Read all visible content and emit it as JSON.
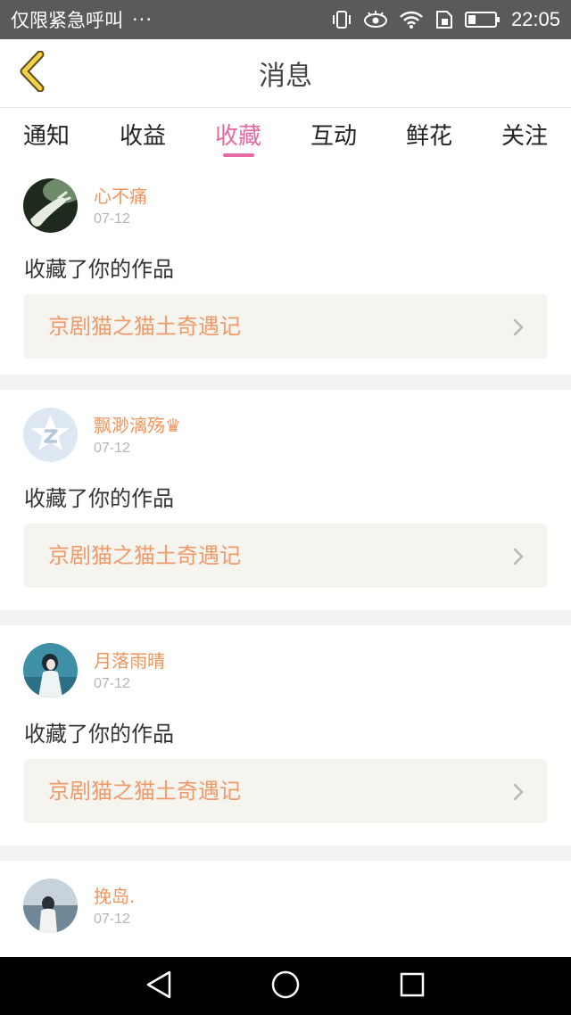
{
  "status_bar": {
    "notice": "仅限紧急呼叫",
    "more": "···",
    "time": "22:05",
    "icons": [
      "vibrate-icon",
      "eye-icon",
      "wifi-icon",
      "sim-icon",
      "battery-icon"
    ]
  },
  "header": {
    "title": "消息",
    "back_icon": "chevron-left-icon"
  },
  "tabs": [
    {
      "label": "通知",
      "active": false
    },
    {
      "label": "收益",
      "active": false
    },
    {
      "label": "收藏",
      "active": true
    },
    {
      "label": "互动",
      "active": false
    },
    {
      "label": "鲜花",
      "active": false
    },
    {
      "label": "关注",
      "active": false
    }
  ],
  "messages": [
    {
      "username": "心不痛",
      "date": "07-12",
      "action": "收藏了你的作品",
      "work_title": "京剧猫之猫土奇遇记"
    },
    {
      "username": "飘渺漓殇♛",
      "date": "07-12",
      "action": "收藏了你的作品",
      "work_title": "京剧猫之猫土奇遇记"
    },
    {
      "username": "月落雨晴",
      "date": "07-12",
      "action": "收藏了你的作品",
      "work_title": "京剧猫之猫土奇遇记"
    },
    {
      "username": "挽岛.",
      "date": "07-12",
      "action": "",
      "work_title": ""
    }
  ],
  "system_nav": {
    "icons": [
      "back-triangle-icon",
      "home-circle-icon",
      "recents-square-icon"
    ]
  },
  "colors": {
    "accent": "#e56aa3",
    "username": "#f0955c",
    "work_link_bg": "#f5f4ee",
    "status_bar_bg": "#5a5a5a"
  }
}
